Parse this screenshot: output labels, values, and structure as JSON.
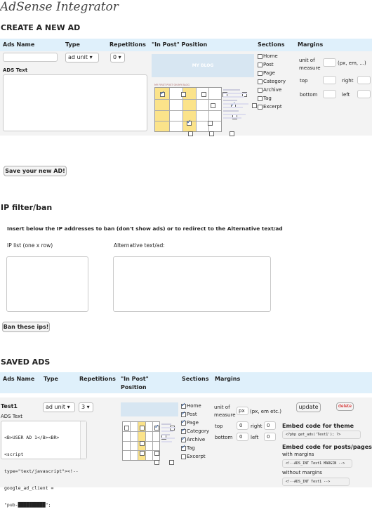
{
  "app_title": "AdSense Integrator",
  "create": {
    "heading": "CREATE A NEW AD",
    "columns": {
      "ads_name": "Ads Name",
      "type": "Type",
      "repetitions": "Repetitions",
      "position": "\"In Post\" Position",
      "sections": "Sections",
      "margins": "Margins"
    },
    "ads_name_value": "",
    "type_value": "ad unit",
    "repetitions_value": "0",
    "ads_text_label": "ADS Text",
    "preview_blog_label": "MY BLOG",
    "preview_post_title": "MY FIRST POST ON MY BLOG",
    "sections": [
      "Home",
      "Post",
      "Page",
      "Category",
      "Archive",
      "Tag",
      "Excerpt"
    ],
    "margins": {
      "unit_label": "unit of measure",
      "unit_hint": "(px, em, ...)",
      "top": "top",
      "right": "right",
      "bottom": "bottom",
      "left": "left"
    },
    "save_button": "Save your new AD!"
  },
  "ipfilter": {
    "heading": "IP filter/ban",
    "instruction": "Insert below the IP addresses to ban (don't show ads) or to redirect to the Alternative text/ad",
    "ip_list_label": "IP list (one x row)",
    "alt_label": "Alternative text/ad:",
    "ban_button": "Ban these ips!"
  },
  "saved": {
    "heading": "SAVED ADS",
    "columns": {
      "ads_name": "Ads Name",
      "type": "Type",
      "repetitions": "Repetitions",
      "position_line1": "\"In Post\"",
      "position_line2": "Position",
      "sections": "Sections",
      "margins": "Margins"
    },
    "ad": {
      "name": "Test1",
      "type": "ad unit",
      "repetitions": "3",
      "ads_text_label": "ADS Text",
      "ads_text_lines": [
        "<B>USER AD 1</B><BR>",
        "<script",
        "type=\"text/javascript\"><!--",
        "google_ad_client =",
        "\"pub-██████████\";"
      ],
      "sections": [
        {
          "label": "Home",
          "checked": true
        },
        {
          "label": "Post",
          "checked": true
        },
        {
          "label": "Page",
          "checked": true
        },
        {
          "label": "Category",
          "checked": true
        },
        {
          "label": "Archive",
          "checked": true
        },
        {
          "label": "Tag",
          "checked": true
        },
        {
          "label": "Excerpt",
          "checked": false
        }
      ],
      "margins": {
        "unit_label": "unit of measure",
        "unit_value": "px",
        "unit_hint": "(px, em etc.)",
        "top": "top",
        "top_value": "0",
        "right": "right",
        "right_value": "0",
        "bottom": "bottom",
        "bottom_value": "0",
        "left": "left",
        "left_value": "0"
      },
      "update_button": "update",
      "delete_button": "delete",
      "embed_theme_label": "Embed code for theme",
      "embed_theme_code": "<?php get_ads('Test1'); ?>",
      "embed_posts_label": "Embed code for posts/pages",
      "with_margins_label": "with margins",
      "with_margins_code": "<!--ADS_INT Test1 MARGIN -->",
      "without_margins_label": "without margins",
      "without_margins_code": "<!--ADS_INT Test1 -->"
    }
  },
  "colors": {
    "header_bar": "#dff0fb",
    "panel": "#f3f3f3",
    "delete_text": "#cc0000",
    "highlight_cell": "#fbe38a"
  }
}
